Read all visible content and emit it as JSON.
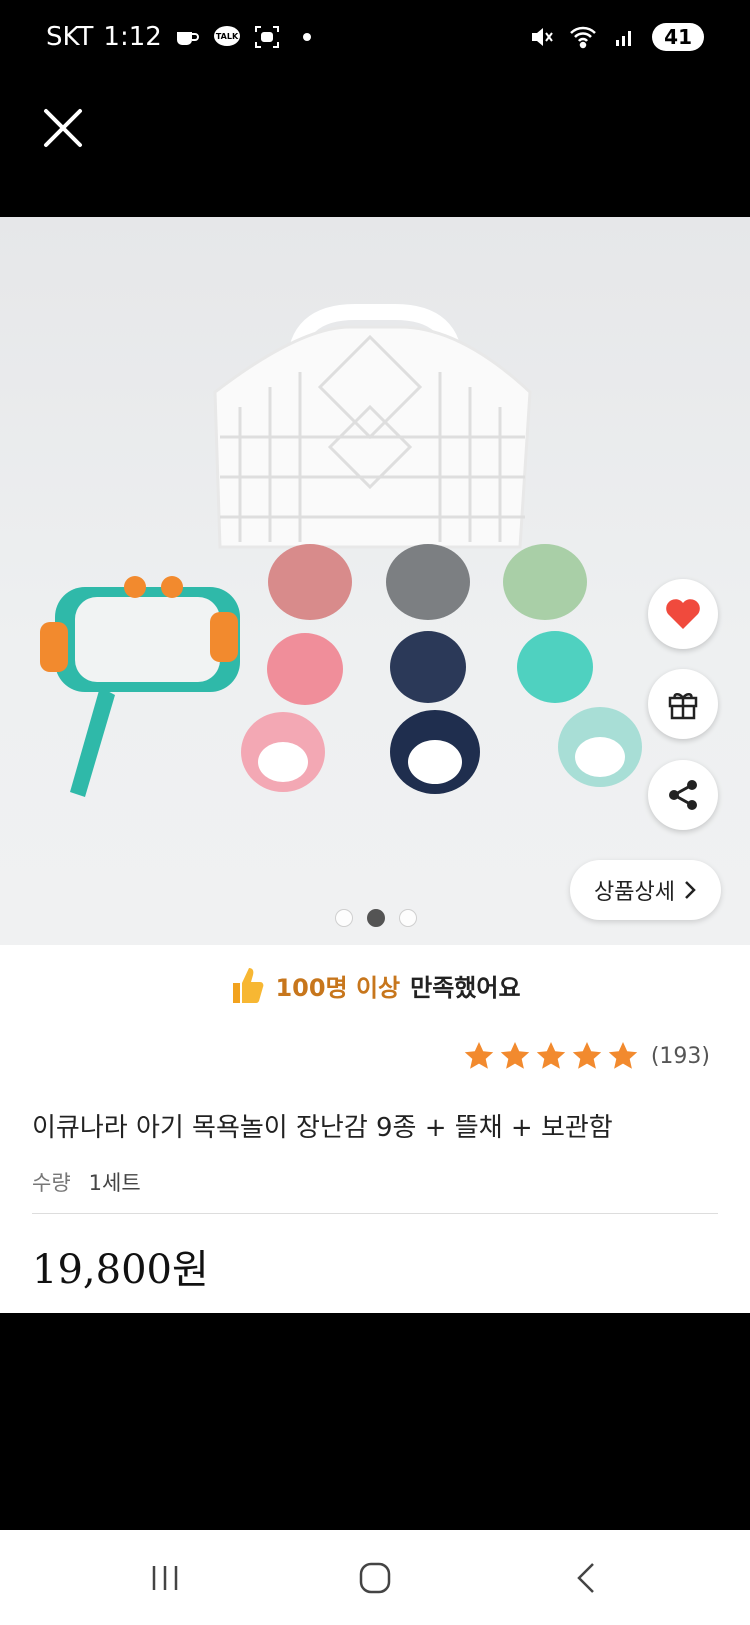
{
  "status_bar": {
    "carrier": "SKT",
    "time": "1:12",
    "battery": "41",
    "icons": [
      "coffee-icon",
      "kakaotalk-icon",
      "screenshot-icon",
      "dot-icon",
      "mute-icon",
      "wifi-icon",
      "signal-icon"
    ]
  },
  "top_bar": {
    "close_icon": "close-icon"
  },
  "product": {
    "satisfaction_strong": "100명 이상",
    "satisfaction_rest": "만족했어요",
    "rating_count": "(193)",
    "stars": 5,
    "title": "이큐나라 아기 목욕놀이 장난감 9종 + 뜰채 + 보관함",
    "qty_label": "수량",
    "qty_value": "1세트",
    "price": "19,800원"
  },
  "image_overlay": {
    "detail_button": "상품상세",
    "page_dots": 3,
    "active_dot": 2,
    "actions": [
      "heart-icon",
      "gift-icon",
      "share-icon"
    ]
  },
  "nav": [
    "recent-apps-icon",
    "home-icon",
    "back-icon"
  ],
  "colors": {
    "heart": "#f04a3d",
    "star": "#f28a2e",
    "satisfaction": "#c7761c"
  }
}
